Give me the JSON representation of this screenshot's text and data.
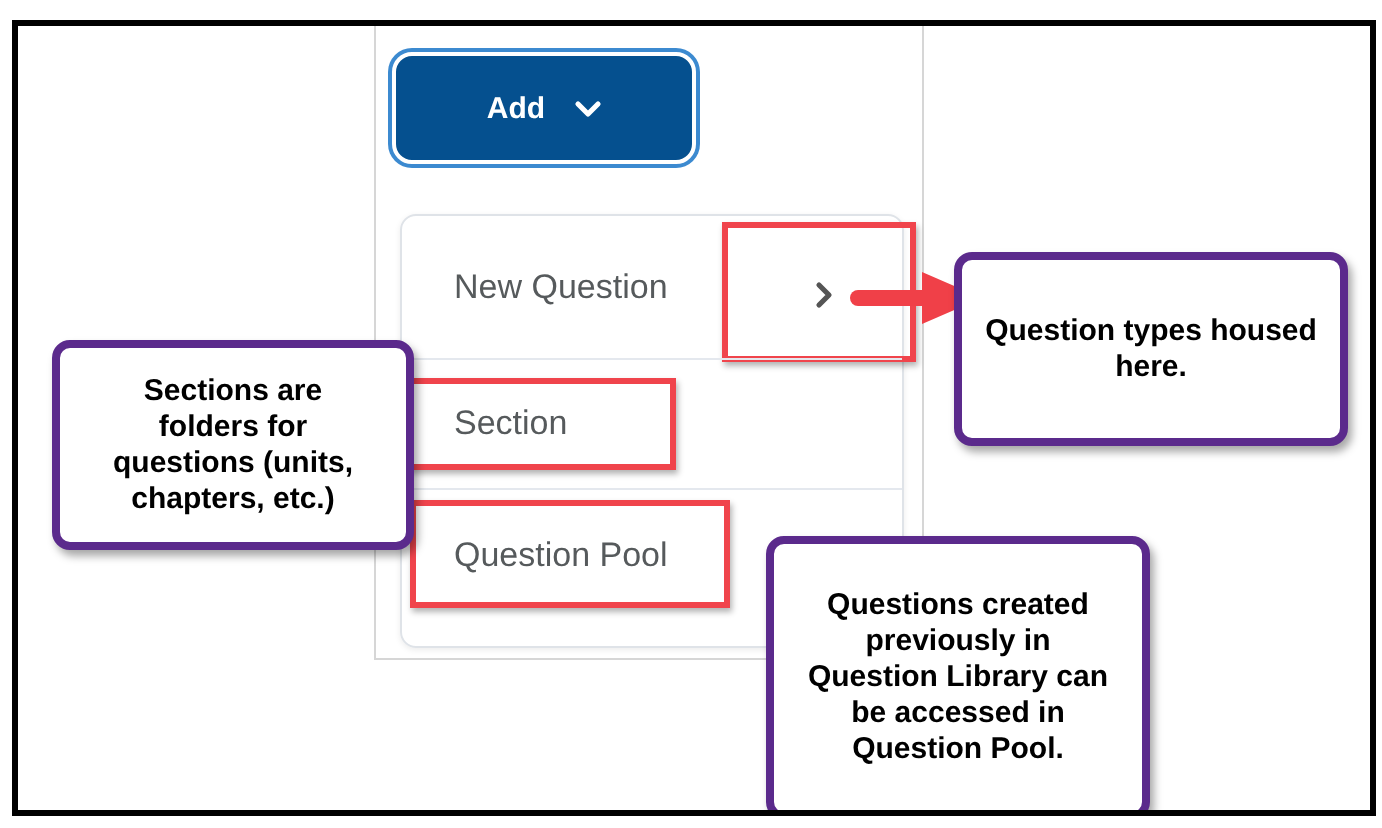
{
  "add_button": {
    "label": "Add"
  },
  "menu": {
    "items": [
      {
        "label": "New Question",
        "kind": "submenu",
        "highlighted": true
      },
      {
        "label": "Section",
        "kind": "plain",
        "highlighted": true
      },
      {
        "label": "Question Pool",
        "kind": "plain",
        "highlighted": true
      }
    ]
  },
  "callouts": [
    {
      "text": "Question types housed here.",
      "arrow": true
    },
    {
      "text": "Sections are folders for questions (units, chapters, etc.)",
      "arrow": false
    },
    {
      "text": "Questions created previously in Question Library can be accessed in Question Pool.",
      "arrow": false
    }
  ]
}
